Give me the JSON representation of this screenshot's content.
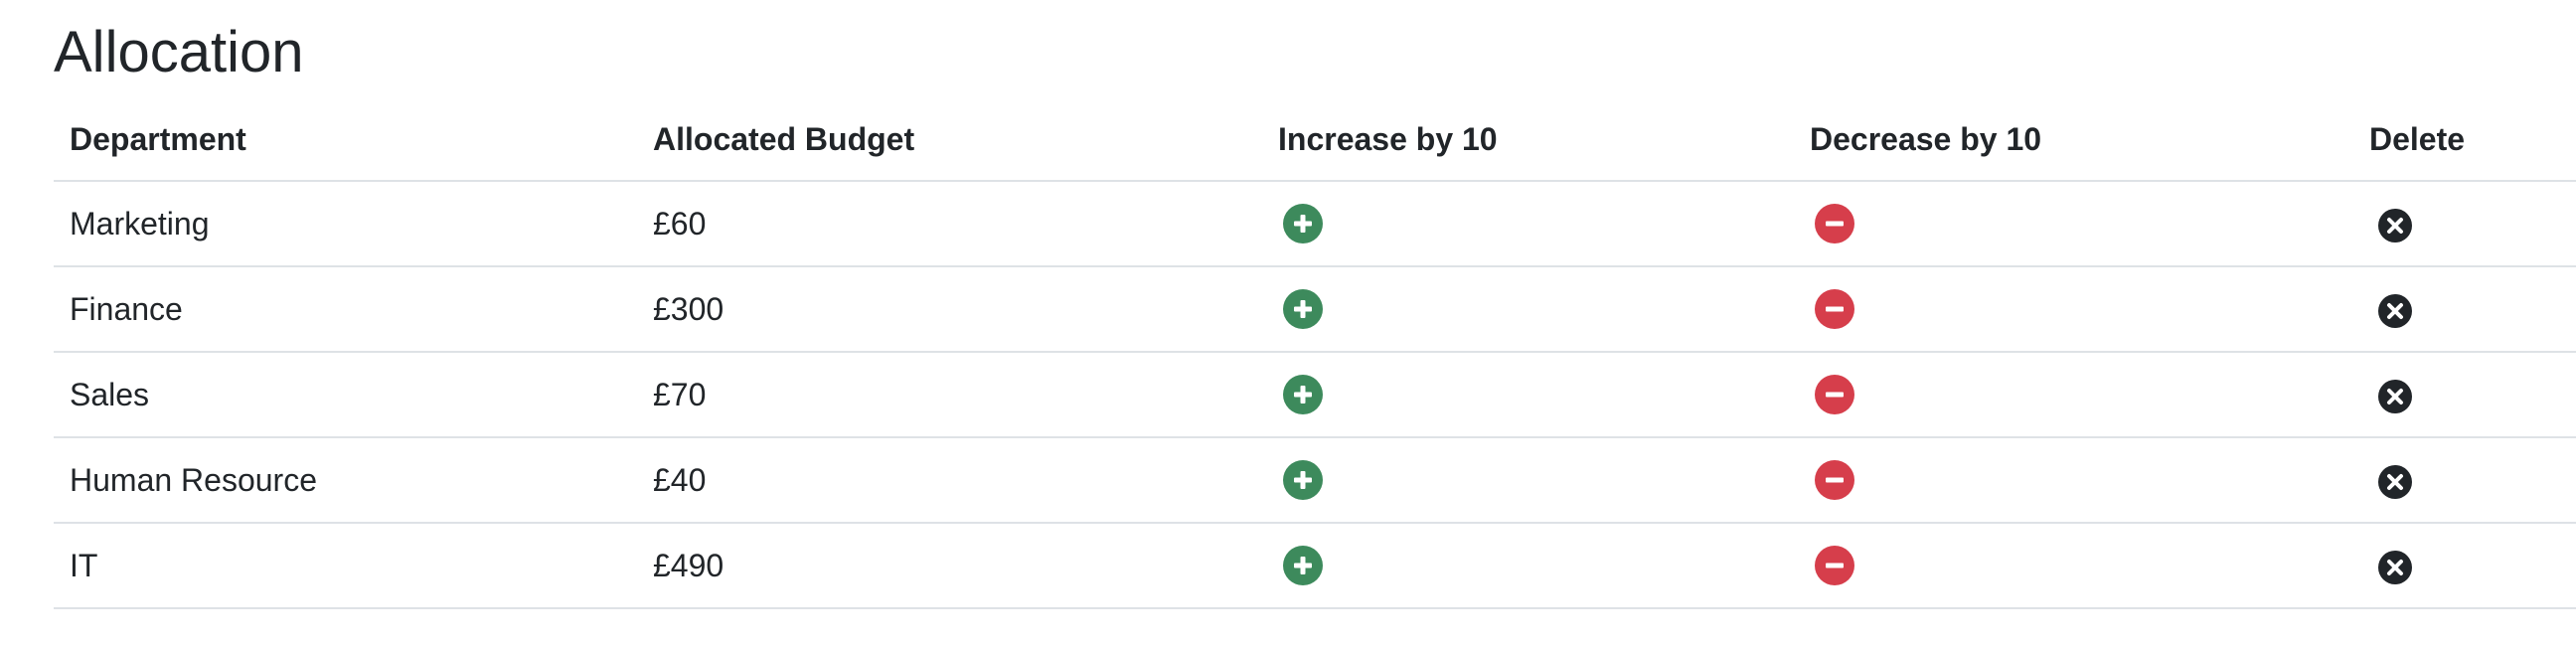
{
  "page": {
    "title": "Allocation"
  },
  "table": {
    "headers": {
      "department": "Department",
      "budget": "Allocated Budget",
      "increase": "Increase by 10",
      "decrease": "Decrease by 10",
      "delete": "Delete"
    },
    "rows": [
      {
        "department": "Marketing",
        "budget": "£60"
      },
      {
        "department": "Finance",
        "budget": "£300"
      },
      {
        "department": "Sales",
        "budget": "£70"
      },
      {
        "department": "Human Resource",
        "budget": "£40"
      },
      {
        "department": "IT",
        "budget": "£490"
      }
    ]
  },
  "icons": {
    "increase": "plus-circle-icon",
    "decrease": "minus-circle-icon",
    "delete": "x-circle-icon"
  },
  "colors": {
    "increase": "#3d8a5c",
    "decrease": "#d63e4b",
    "delete": "#212529",
    "text": "#212529",
    "border": "#dee2e6"
  }
}
